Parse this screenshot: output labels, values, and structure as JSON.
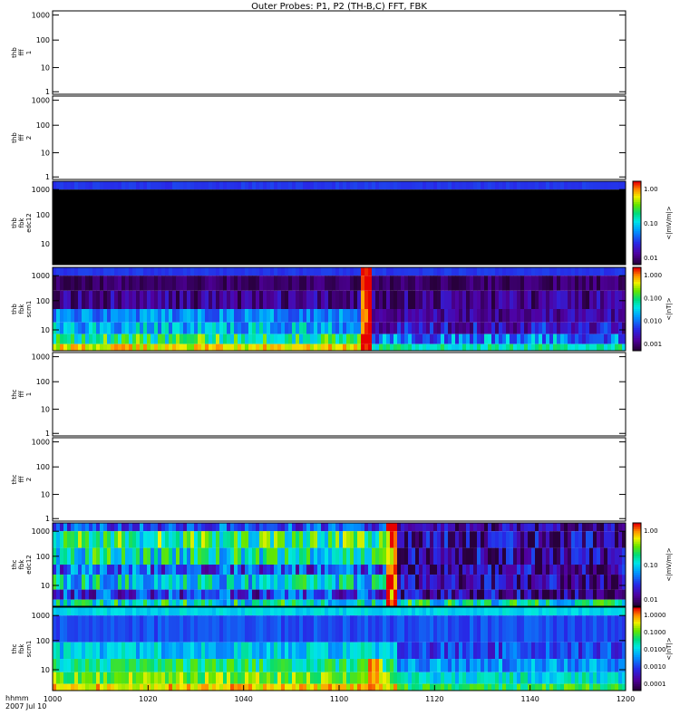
{
  "title": "Outer Probes: P1, P2 (TH-B,C) FFT, FBK",
  "footer": {
    "line1": "hhmm",
    "line2": "2007 Jul 10"
  },
  "chart_data": {
    "type": "heatmap",
    "x_ticks": [
      "1000",
      "1020",
      "1040",
      "1100",
      "1120",
      "1140",
      "1200"
    ],
    "panels": [
      {
        "ylabel": [
          "thb",
          "fff",
          "1"
        ],
        "yticks": [
          "1000",
          "100",
          "10",
          "1"
        ],
        "filled": false
      },
      {
        "ylabel": [
          "thb",
          "fff",
          "2"
        ],
        "yticks": [
          "1000",
          "100",
          "10",
          "1"
        ],
        "filled": false
      },
      {
        "ylabel": [
          "thb",
          "fbk",
          "edc12"
        ],
        "yticks": [
          "1000",
          "100",
          "10"
        ],
        "filled": true,
        "colorbar": {
          "label": "<|mV/m|>",
          "ticks": [
            "1.00",
            "0.10",
            "0.01"
          ]
        }
      },
      {
        "ylabel": [
          "thb",
          "fbk",
          "scm1"
        ],
        "yticks": [
          "1000",
          "100",
          "10"
        ],
        "filled": true,
        "colorbar": {
          "label": "<|nT|>",
          "ticks": [
            "1.000",
            "0.100",
            "0.010",
            "0.001"
          ]
        }
      },
      {
        "ylabel": [
          "thc",
          "fff",
          "1"
        ],
        "yticks": [
          "1000",
          "100",
          "10",
          "1"
        ],
        "filled": false
      },
      {
        "ylabel": [
          "thc",
          "fff",
          "2"
        ],
        "yticks": [
          "1000",
          "100",
          "10",
          "1"
        ],
        "filled": false
      },
      {
        "ylabel": [
          "thc",
          "fbk",
          "edc12"
        ],
        "yticks": [
          "1000",
          "100",
          "10"
        ],
        "filled": true,
        "colorbar": {
          "label": "<|mV/m|>",
          "ticks": [
            "1.00",
            "0.10",
            "0.01"
          ]
        }
      },
      {
        "ylabel": [
          "thc",
          "fbk",
          "scm1"
        ],
        "yticks": [
          "1000",
          "100",
          "10"
        ],
        "filled": true,
        "colorbar": {
          "label": "<|nT|>",
          "ticks": [
            "1.0000",
            "0.1000",
            "0.0100",
            "0.0010",
            "0.0001"
          ]
        }
      }
    ]
  }
}
